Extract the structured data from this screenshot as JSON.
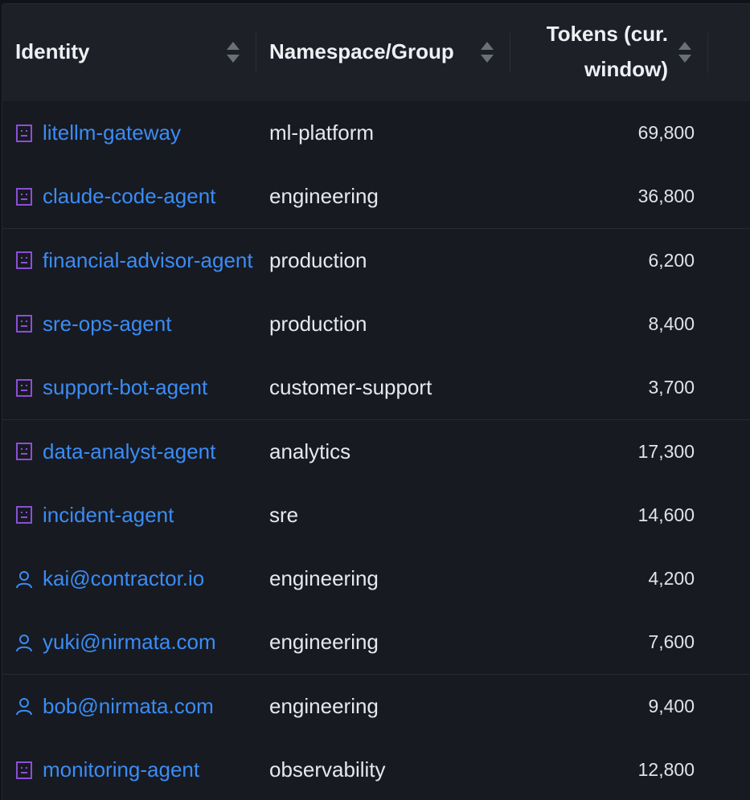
{
  "table": {
    "columns": [
      {
        "label": "Identity"
      },
      {
        "label": "Namespace/Group"
      },
      {
        "label_line1": "Tokens (cur.",
        "label_line2": "window)"
      }
    ],
    "rows": [
      {
        "identity": "litellm-gateway",
        "type": "agent",
        "namespace": "ml-platform",
        "tokens": "69,800"
      },
      {
        "identity": "claude-code-agent",
        "type": "agent",
        "namespace": "engineering",
        "tokens": "36,800"
      },
      {
        "identity": "financial-advisor-agent",
        "type": "agent",
        "namespace": "production",
        "tokens": "6,200"
      },
      {
        "identity": "sre-ops-agent",
        "type": "agent",
        "namespace": "production",
        "tokens": "8,400"
      },
      {
        "identity": "support-bot-agent",
        "type": "agent",
        "namespace": "customer-support",
        "tokens": "3,700"
      },
      {
        "identity": "data-analyst-agent",
        "type": "agent",
        "namespace": "analytics",
        "tokens": "17,300"
      },
      {
        "identity": "incident-agent",
        "type": "agent",
        "namespace": "sre",
        "tokens": "14,600"
      },
      {
        "identity": "kai@contractor.io",
        "type": "user",
        "namespace": "engineering",
        "tokens": "4,200"
      },
      {
        "identity": "yuki@nirmata.com",
        "type": "user",
        "namespace": "engineering",
        "tokens": "7,600"
      },
      {
        "identity": "bob@nirmata.com",
        "type": "user",
        "namespace": "engineering",
        "tokens": "9,400"
      },
      {
        "identity": "monitoring-agent",
        "type": "agent",
        "namespace": "observability",
        "tokens": "12,800"
      }
    ]
  },
  "icons": {
    "agent": "robot-icon",
    "user": "user-icon",
    "sort": "sort-icon"
  },
  "colors": {
    "link": "#3b8cf5",
    "agent_icon": "#8b4fd6",
    "user_icon": "#3b8cf5"
  }
}
